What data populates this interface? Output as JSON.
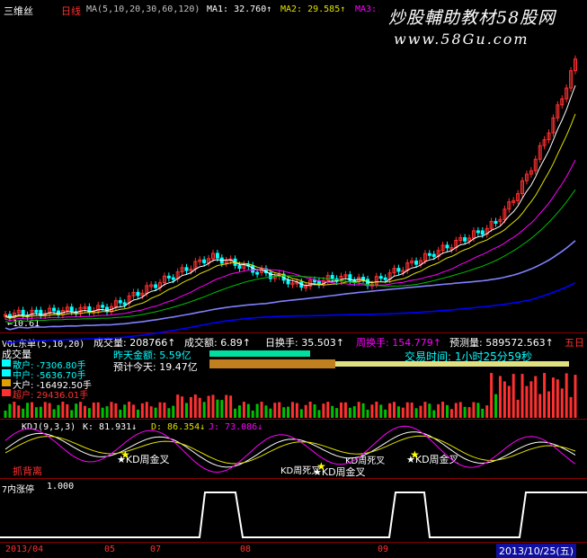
{
  "price_header": {
    "title": "三维丝",
    "period": "日线",
    "ma_params": "MA(5,10,20,30,60,120)",
    "ma1": "MA1: 32.760↑",
    "ma2": "MA2: 29.585↑",
    "ma3": "MA3:"
  },
  "watermark": {
    "line1": "炒股輔助教材58股网",
    "line2": "www.58Gu.com"
  },
  "price_low_label": "←10.61",
  "vol_header": {
    "title": "VOL东单(5,10,20)",
    "vol": "成交量: 208766↑",
    "amount": "成交额: 6.89↑",
    "turnover": "日换手: 35.503↑",
    "week_turnover": "周换手: 154.779↑",
    "forecast": "预测量: 589572.563↑",
    "five_day": "五日"
  },
  "vol_info": {
    "label": "成交量",
    "yesterday": "昨天金额: 5.59亿",
    "today": "预计今天: 19.47亿",
    "trade_time": "交易时间: 1小时25分59秒"
  },
  "holders": [
    {
      "text": "散户: -7306.80手",
      "color": "#00ffff"
    },
    {
      "text": "中户: -5636.70手",
      "color": "#00ffff"
    },
    {
      "text": "大户: -16492.50手",
      "color": "#ffffff"
    },
    {
      "text": "超户: 29436.01手",
      "color": "#ff3030"
    }
  ],
  "kdj_header": {
    "title": "KDJ(9,3,3)",
    "k": "K: 81.931↓",
    "d": "D: 86.354↓",
    "j": "J: 73.086↓"
  },
  "kdj_labels": {
    "bottom": "抓背离",
    "cross1": "★KD周金叉",
    "cross2": "KD周死叉",
    "cross3": "★KD周金叉",
    "cross4": "KD周死叉",
    "cross5": "★KD周金叉"
  },
  "limit_header": {
    "title": "7内涨停",
    "value": "1.000"
  },
  "xaxis": {
    "labels": [
      "2013/04",
      "05",
      "07",
      "08",
      "09"
    ],
    "current_date": "2013/10/25(五)"
  },
  "colors": {
    "up": "#ff3030",
    "down": "#00ffff",
    "ma1": "#ffffff",
    "ma2": "#e0e000",
    "ma3": "#ff00ff",
    "ma4": "#00c000",
    "ma5": "#8080ff",
    "ma6": "#0000ff",
    "border": "#8a0000"
  }
}
